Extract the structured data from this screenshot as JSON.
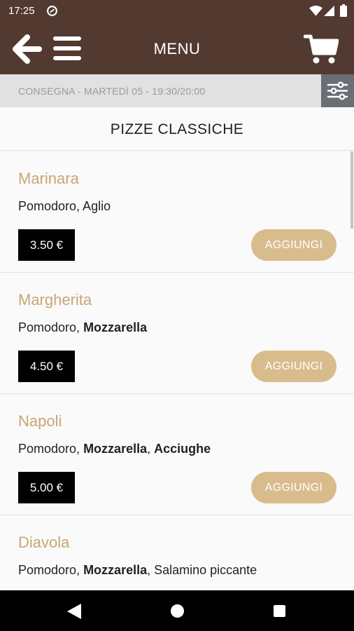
{
  "status_bar": {
    "time": "17:25"
  },
  "app_bar": {
    "title": "MENU"
  },
  "delivery": {
    "text": "CONSEGNA - MARTEDÌ 05 - 19:30/20:00"
  },
  "section": {
    "title": "PIZZE CLASSICHE"
  },
  "items": [
    {
      "name": "Marinara",
      "desc_parts": [
        "Pomodoro, Aglio"
      ],
      "price": "3.50 €",
      "add_label": "AGGIUNGI"
    },
    {
      "name": "Margherita",
      "desc_parts": [
        "Pomodoro, ",
        "Mozzarella"
      ],
      "price": "4.50 €",
      "add_label": "AGGIUNGI"
    },
    {
      "name": "Napoli",
      "desc_parts": [
        "Pomodoro, ",
        "Mozzarella",
        ", ",
        "Acciughe"
      ],
      "price": "5.00 €",
      "add_label": "AGGIUNGI"
    },
    {
      "name": "Diavola",
      "desc_parts": [
        "Pomodoro, ",
        "Mozzarella",
        ", Salamino piccante"
      ],
      "price": "",
      "add_label": ""
    }
  ],
  "icons": {
    "back": "arrow-left-icon",
    "menu": "hamburger-menu-icon",
    "cart": "shopping-cart-icon",
    "filter": "sliders-filter-icon"
  },
  "colors": {
    "app_bar": "#523a30",
    "item_name": "#c9a674",
    "add_button": "#d9bc8c",
    "price_bg": "#000000",
    "filter_button": "#6a6e75"
  }
}
